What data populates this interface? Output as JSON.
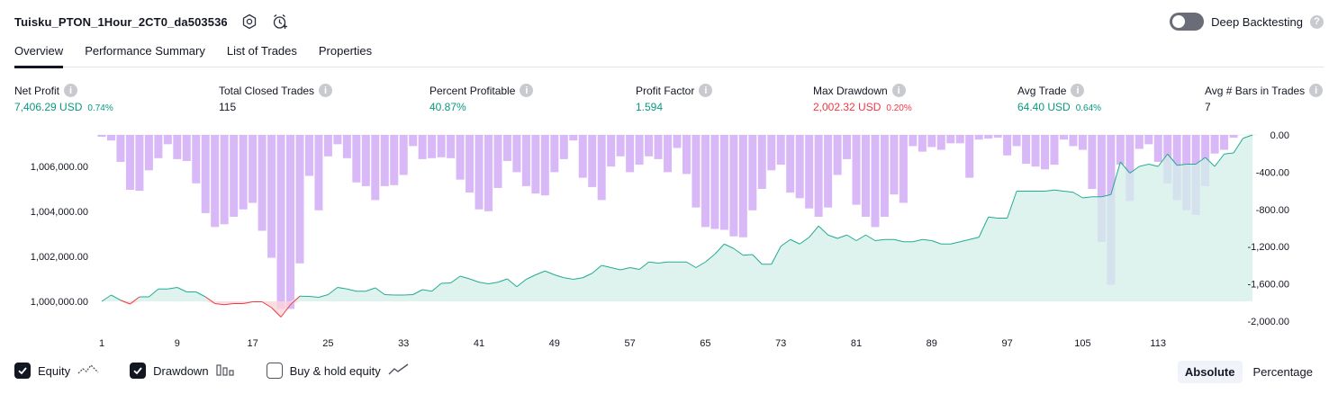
{
  "header": {
    "title": "Tuisku_PTON_1Hour_2CT0_da503536",
    "deep_backtesting_label": "Deep Backtesting",
    "deep_backtesting_on": false
  },
  "tabs": [
    {
      "label": "Overview",
      "active": true
    },
    {
      "label": "Performance Summary",
      "active": false
    },
    {
      "label": "List of Trades",
      "active": false
    },
    {
      "label": "Properties",
      "active": false
    }
  ],
  "metrics": {
    "net_profit": {
      "label": "Net Profit",
      "value": "7,406.29 USD",
      "pct": "0.74%"
    },
    "total_closed_trades": {
      "label": "Total Closed Trades",
      "value": "115"
    },
    "percent_profitable": {
      "label": "Percent Profitable",
      "value": "40.87%"
    },
    "profit_factor": {
      "label": "Profit Factor",
      "value": "1.594"
    },
    "max_drawdown": {
      "label": "Max Drawdown",
      "value": "2,002.32 USD",
      "pct": "0.20%"
    },
    "avg_trade": {
      "label": "Avg Trade",
      "value": "64.40 USD",
      "pct": "0.64%"
    },
    "avg_bars": {
      "label": "Avg # Bars in Trades",
      "value": "7"
    }
  },
  "legend": {
    "equity": {
      "label": "Equity",
      "checked": true
    },
    "drawdown": {
      "label": "Drawdown",
      "checked": true
    },
    "buy_hold": {
      "label": "Buy & hold equity",
      "checked": false
    }
  },
  "mode": {
    "absolute": "Absolute",
    "percentage": "Percentage",
    "active": "Absolute"
  },
  "colors": {
    "equity_line": "#22ab94",
    "equity_below": "#f23645",
    "equity_fill": "#d3efe8",
    "drawdown_bar": "#d9b8f7",
    "green": "#089981",
    "red": "#f23645"
  },
  "chart_data": {
    "type": "bar+area",
    "x_ticks": [
      1,
      9,
      17,
      25,
      33,
      41,
      49,
      57,
      65,
      73,
      81,
      89,
      97,
      105,
      113
    ],
    "x_range": [
      1,
      116
    ],
    "left_axis": {
      "ticks": [
        "1,000,000.00",
        "1,002,000.00",
        "1,004,000.00",
        "1,006,000.00"
      ],
      "tick_values": [
        1000000,
        1002000,
        1004000,
        1006000
      ],
      "range": [
        999000,
        1007400
      ]
    },
    "right_axis": {
      "ticks": [
        "0.00",
        "-400.00",
        "-800.00",
        "-1,200.00",
        "-1,600.00",
        "-2,000.00"
      ],
      "tick_values": [
        0,
        -400,
        -800,
        -1200,
        -1600,
        -2000
      ],
      "range": [
        -2030,
        0
      ]
    },
    "series": [
      {
        "name": "Equity",
        "axis": "left",
        "baseline": 1000000,
        "values": [
          1000000,
          1000280,
          1000050,
          999880,
          1000200,
          1000200,
          1000550,
          1000550,
          1000620,
          1000420,
          1000420,
          1000200,
          999900,
          999850,
          999900,
          999900,
          999980,
          999980,
          999720,
          999300,
          999850,
          1000230,
          1000220,
          1000180,
          1000300,
          1000620,
          1000550,
          1000450,
          1000450,
          1000600,
          1000300,
          1000280,
          1000280,
          1000300,
          1000520,
          1000450,
          1000800,
          1000820,
          1001120,
          1001000,
          1000850,
          1000780,
          1000850,
          1001000,
          1000650,
          1000980,
          1001180,
          1001350,
          1001180,
          1001050,
          1000980,
          1001050,
          1001250,
          1001600,
          1001500,
          1001400,
          1001500,
          1001420,
          1001750,
          1001700,
          1001750,
          1001750,
          1001750,
          1001500,
          1001750,
          1002100,
          1002550,
          1002350,
          1002050,
          1002080,
          1001650,
          1001650,
          1002450,
          1002750,
          1002550,
          1002850,
          1003350,
          1002950,
          1002800,
          1002950,
          1002700,
          1002950,
          1002700,
          1002750,
          1002750,
          1002650,
          1002650,
          1002750,
          1002700,
          1002550,
          1002550,
          1002650,
          1002750,
          1002850,
          1003750,
          1003700,
          1003700,
          1004900,
          1004900,
          1004900,
          1004900,
          1004950,
          1004900,
          1004850,
          1004600,
          1004650,
          1004650,
          1004750,
          1006200,
          1005700,
          1006000,
          1006100,
          1006000,
          1006550,
          1006050,
          1006100,
          1006100,
          1006400,
          1006000,
          1006550,
          1006600,
          1007250,
          1007400
        ]
      },
      {
        "name": "Drawdown",
        "axis": "right",
        "values": [
          -20,
          -60,
          -290,
          -590,
          -600,
          -380,
          -250,
          -100,
          -260,
          -280,
          -520,
          -840,
          -990,
          -960,
          -880,
          -800,
          -730,
          -1030,
          -1320,
          -1870,
          -1870,
          -1380,
          -440,
          -810,
          -230,
          -100,
          -250,
          -510,
          -550,
          -700,
          -550,
          -540,
          -430,
          -120,
          -260,
          -250,
          -240,
          -250,
          -480,
          -620,
          -800,
          -820,
          -570,
          -280,
          -400,
          -550,
          -630,
          -650,
          -400,
          -260,
          -60,
          -460,
          -560,
          -700,
          -340,
          -230,
          -400,
          -320,
          -230,
          -260,
          -400,
          -140,
          -420,
          -780,
          -990,
          -1010,
          -1020,
          -1090,
          -1100,
          -810,
          -580,
          -380,
          -320,
          -620,
          -680,
          -790,
          -880,
          -780,
          -430,
          -260,
          -750,
          -880,
          -990,
          -880,
          -640,
          -730,
          -120,
          -180,
          -130,
          -160,
          -90,
          -90,
          -460,
          -50,
          -40,
          -30,
          -220,
          -120,
          -310,
          -340,
          -370,
          -320,
          -50,
          -120,
          -160,
          -580,
          -1150,
          -1610,
          -320,
          -710,
          -150,
          -100,
          -290,
          -520,
          -700,
          -810,
          -860,
          -550,
          -200,
          -160,
          -30
        ]
      }
    ]
  }
}
